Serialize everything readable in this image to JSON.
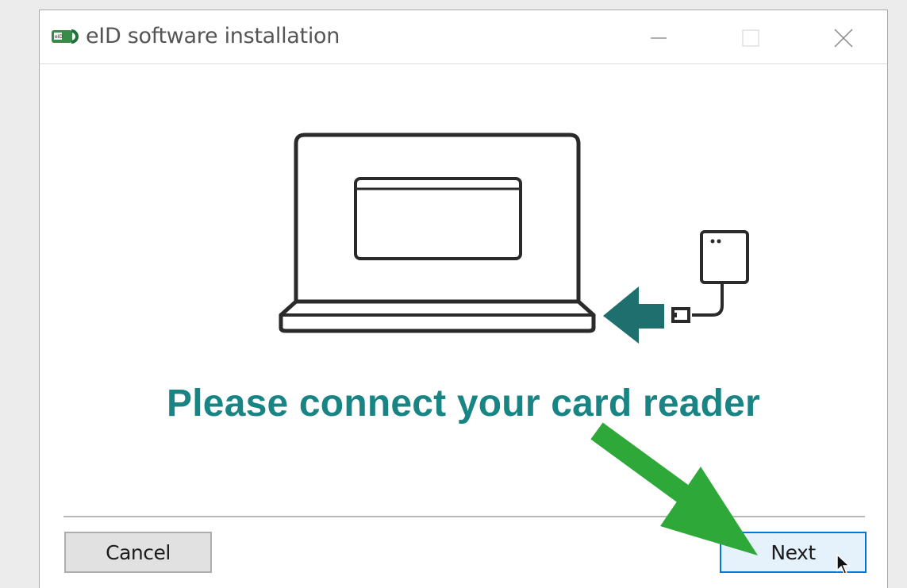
{
  "window": {
    "title": "eID software installation",
    "icon": "eid-card-reader-icon",
    "controls": [
      "minimize-icon",
      "maximize-icon",
      "close-icon"
    ]
  },
  "main": {
    "illustration": "laptop-with-card-reader-illustration",
    "message": "Please connect your card reader"
  },
  "footer": {
    "cancel_label": "Cancel",
    "next_label": "Next"
  },
  "colors": {
    "accent": "#188483",
    "arrow_teal": "#1f6f6e",
    "highlight_arrow": "#2fa83a",
    "next_border": "#0078d7"
  }
}
